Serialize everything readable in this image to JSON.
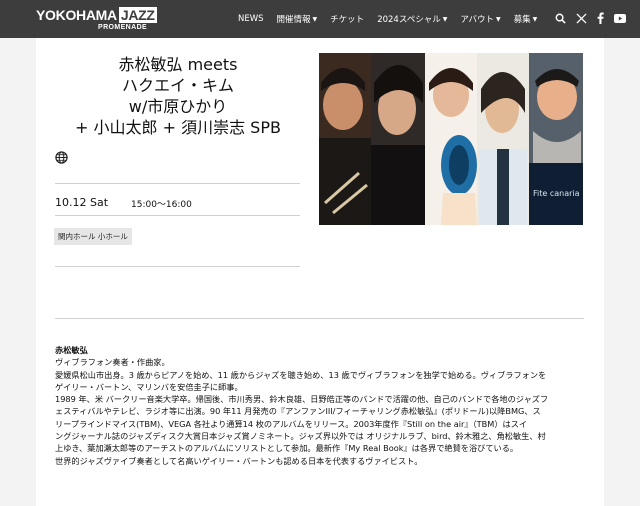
{
  "header": {
    "logo_main": "YOKOHAMA",
    "logo_jazz": "JAZZ",
    "logo_sub": "PROMENADE",
    "nav": [
      {
        "label": "NEWS",
        "has_dropdown": false
      },
      {
        "label": "開催情報",
        "has_dropdown": true
      },
      {
        "label": "チケット",
        "has_dropdown": false
      },
      {
        "label": "2024スペシャル",
        "has_dropdown": true
      },
      {
        "label": "アバウト",
        "has_dropdown": true
      },
      {
        "label": "募集",
        "has_dropdown": true
      }
    ],
    "icons": [
      "search-icon",
      "x-icon",
      "facebook-icon",
      "youtube-icon"
    ]
  },
  "event": {
    "title_lines": [
      "赤松敏弘 meets",
      "ハクエイ・キム",
      "w/市原ひかり",
      "+ 小山太郎 + 須川崇志 SPB"
    ],
    "date": "10.12 Sat",
    "time": "15:00〜16:00",
    "venue": "関内ホール 小ホール",
    "photo_text": "Fite canaria"
  },
  "bio": {
    "name": "赤松敏弘",
    "lines": [
      "ヴィブラフォン奏者・作曲家。",
      "愛媛県松山市出身。3 歳からピアノを始め、11 歳からジャズを聴き始め、13 歳でヴィブラフォンを独学で始める。ヴィブラフォンを",
      "ゲイリー・バートン、マリンバを安倍圭子に師事。",
      "1989 年、米 バークリー音楽大学卒。帰国後、市川秀男、鈴木良雄、日野皓正等のバンドで活躍の他、自己のバンドで各地のジャズフ",
      "ェスティバルやテレビ、ラジオ等に出演。90 年11 月発売の『アンファンIII/フィーチャリング赤松敏弘』(ポリドール)以降BMG、ス",
      "リープラインドマイス(TBM)、VEGA 各社より通算14 枚のアルバムをリリース。2003年度作『Still on the air』（TBM）はスイ",
      "ングジャーナル誌のジャズディスク大賞日本ジャズ賞ノミネート。ジャズ界以外では オリジナルラブ、bird、鈴木雅之、角松敏生、村",
      "上ゆき、葉加瀬太郎等のアーチストのアルバムにソリストとして参加。最新作『My Real Book』は各界で絶賛を浴びている。",
      "世界的ジャズヴァイブ奏者として名高いゲイリー・バートンも認める日本を代表するヴァイビスト。"
    ]
  }
}
